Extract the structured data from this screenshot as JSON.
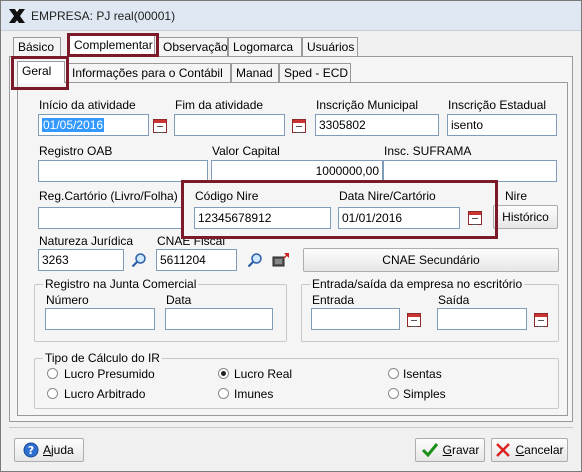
{
  "window": {
    "title": "EMPRESA: PJ real(00001)"
  },
  "tabs_top": [
    "Básico",
    "Complementar",
    "Observação",
    "Logomarca",
    "Usuários"
  ],
  "tabs_sub": [
    "Geral",
    "Informações para o Contábil",
    "Manad",
    "Sped - ECD"
  ],
  "fields": {
    "inicio_atividade": {
      "label": "Início da atividade",
      "value": "01/05/2016"
    },
    "fim_atividade": {
      "label": "Fim da atividade",
      "value": ""
    },
    "inscricao_municipal": {
      "label": "Inscrição Municipal",
      "value": "3305802"
    },
    "inscricao_estadual": {
      "label": "Inscrição Estadual",
      "value": "isento"
    },
    "registro_oab": {
      "label": "Registro OAB",
      "value": ""
    },
    "valor_capital": {
      "label": "Valor Capital",
      "value": "1000000,00"
    },
    "insc_suframa": {
      "label": "Insc. SUFRAMA",
      "value": ""
    },
    "reg_cartorio": {
      "label": "Reg.Cartório (Livro/Folha)",
      "value": ""
    },
    "codigo_nire": {
      "label": "Código Nire",
      "value": "12345678912"
    },
    "data_nire": {
      "label": "Data Nire/Cartório",
      "value": "01/01/2016"
    },
    "nire_partial": {
      "label": "Nire"
    },
    "natureza_juridica": {
      "label": "Natureza Jurídica",
      "value": "3263"
    },
    "cnae_fiscal": {
      "label": "CNAE Fiscal",
      "value": "5611204"
    }
  },
  "buttons": {
    "historico": "Histórico",
    "cnae_secundario": "CNAE Secundário",
    "ajuda_prefix": "A",
    "ajuda_rest": "juda",
    "gravar_prefix": "G",
    "gravar_rest": "ravar",
    "cancelar_prefix": "C",
    "cancelar_rest": "ancelar"
  },
  "junta": {
    "title": "Registro na Junta Comercial",
    "numero_label": "Número",
    "numero_value": "",
    "data_label": "Data",
    "data_value": ""
  },
  "entrada_saida": {
    "title": "Entrada/saída da empresa no escritório",
    "entrada_label": "Entrada",
    "entrada_value": "",
    "saida_label": "Saída",
    "saida_value": ""
  },
  "calculo_ir": {
    "title": "Tipo de Cálculo do IR",
    "options": [
      "Lucro Presumido",
      "Lucro Real",
      "Isentas",
      "Lucro Arbitrado",
      "Imunes",
      "Simples"
    ],
    "selected": "Lucro Real"
  },
  "colors": {
    "highlight": "#7b1b2a",
    "selection": "#3399ff",
    "accent_icon": "#1a8f1a"
  }
}
